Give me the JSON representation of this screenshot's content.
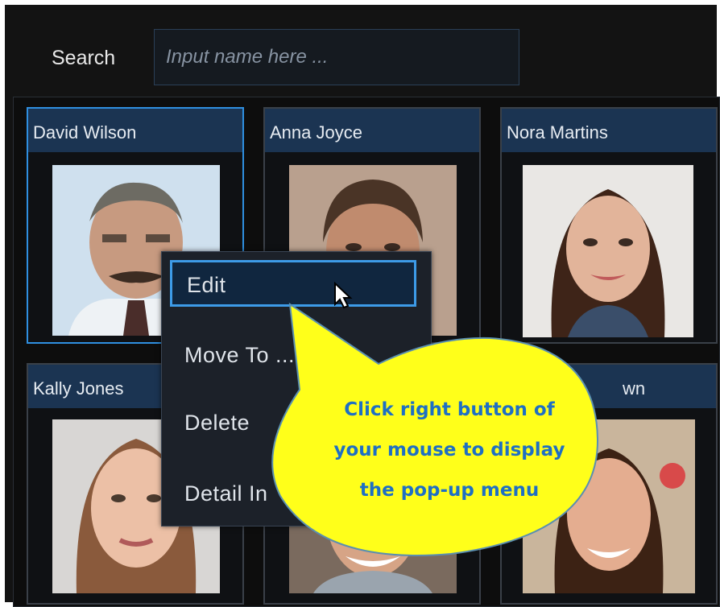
{
  "search": {
    "label": "Search",
    "placeholder": "Input name here ...",
    "value": ""
  },
  "cards": [
    {
      "name": "David Wilson",
      "selected": true
    },
    {
      "name": "Anna Joyce",
      "selected": false
    },
    {
      "name": "Nora Martins",
      "selected": false
    },
    {
      "name": "Kally Jones",
      "selected": false
    },
    {
      "name": "",
      "selected": false
    },
    {
      "name": "wn",
      "selected": false
    }
  ],
  "context_menu": {
    "items": [
      {
        "label": "Edit",
        "active": true
      },
      {
        "label": "Move To ...",
        "active": false
      },
      {
        "label": "Delete",
        "active": false
      },
      {
        "label": "Detail In",
        "active": false
      }
    ]
  },
  "callout": {
    "lines": [
      "Click right button of",
      "your mouse to display",
      "the pop-up menu"
    ],
    "fill": "#ffff1a",
    "text_color": "#1e6fc4"
  },
  "colors": {
    "background": "#131313",
    "header": "#1b3452",
    "selection": "#2f8fe0"
  }
}
